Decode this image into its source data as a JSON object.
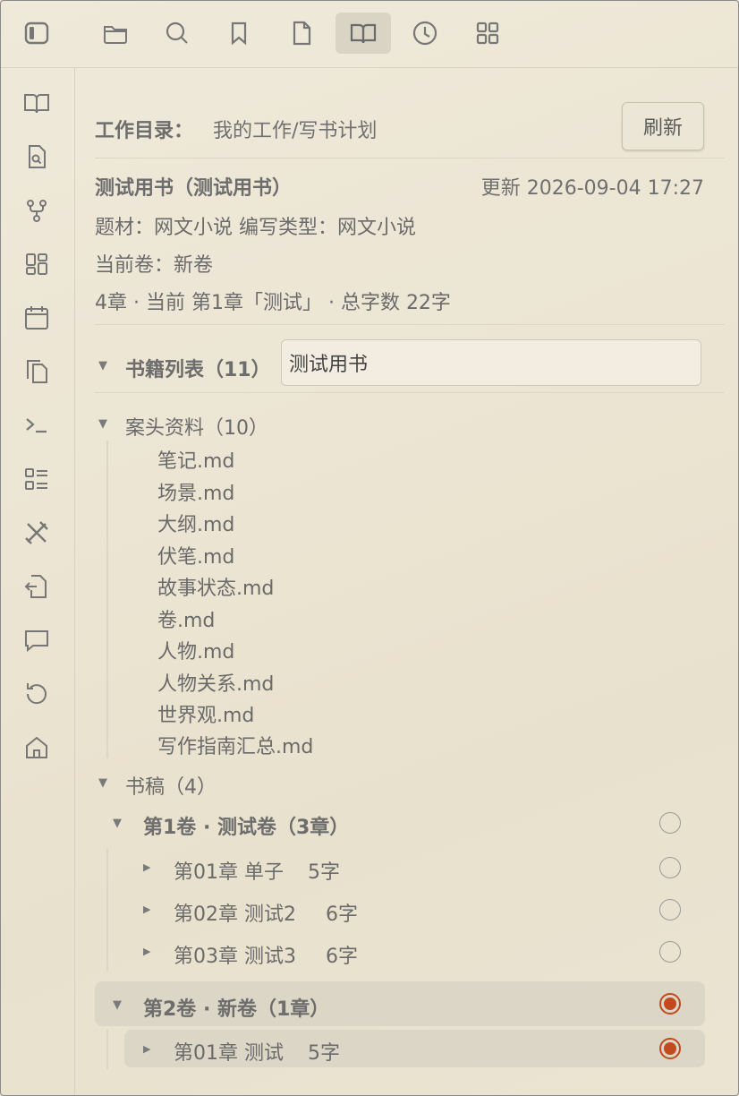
{
  "toolbar": {
    "icons": [
      "sidebar-toggle-icon",
      "folder-icon",
      "search-icon",
      "bookmark-icon",
      "file-icon",
      "book-open-icon",
      "clock-icon",
      "grid-icon"
    ],
    "active": "book-open-icon"
  },
  "rail": {
    "icons": [
      "book-icon",
      "file-search-icon",
      "git-fork-icon",
      "dashboard-icon",
      "calendar-icon",
      "copy-icon",
      "terminal-icon",
      "list-icon",
      "tools-icon",
      "file-export-icon",
      "chat-icon",
      "history-icon",
      "home-icon"
    ]
  },
  "workdir": {
    "label": "工作目录：",
    "path": "我的工作/写书计划",
    "refresh_label": "刷新"
  },
  "book": {
    "title": "测试用书（测试用书）",
    "updated": "更新 2026-09-04 17:27",
    "genre_line": "题材：网文小说 编写类型：网文小说",
    "current_volume": "当前卷：新卷",
    "stats": "4章 · 当前 第1章「测试」 · 总字数 22字"
  },
  "book_list": {
    "label": "书籍列表（11）",
    "input_value": "测试用书"
  },
  "desk_materials": {
    "label": "案头资料（10）",
    "files": [
      "笔记.md",
      "场景.md",
      "大纲.md",
      "伏笔.md",
      "故事状态.md",
      "卷.md",
      "人物.md",
      "人物关系.md",
      "世界观.md",
      "写作指南汇总.md"
    ]
  },
  "manuscript": {
    "label": "书稿（4）",
    "volumes": [
      {
        "title": "第1卷 · 测试卷（3章）",
        "selected": false,
        "chapters": [
          {
            "title": "第01章 单子",
            "words": "5字",
            "selected": false
          },
          {
            "title": "第02章 测试2",
            "words": "6字",
            "selected": false
          },
          {
            "title": "第03章 测试3",
            "words": "6字",
            "selected": false
          }
        ]
      },
      {
        "title": "第2卷 · 新卷（1章）",
        "selected": true,
        "chapters": [
          {
            "title": "第01章 测试",
            "words": "5字",
            "selected": true
          }
        ]
      }
    ]
  },
  "colors": {
    "accent": "#c24a1e",
    "background": "#ece5d3"
  }
}
